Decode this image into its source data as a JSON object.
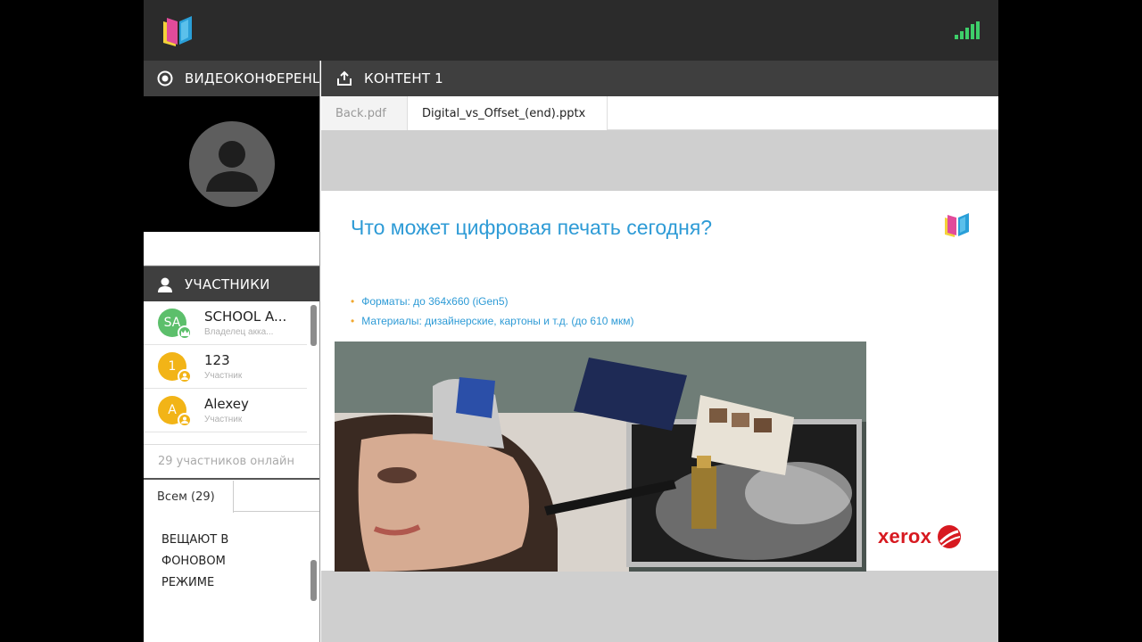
{
  "panels": {
    "video": {
      "title": "ВИДЕОКОНФЕРЕНЦИЯ"
    },
    "participants": {
      "title": "УЧАСТНИКИ"
    },
    "content": {
      "title": "КОНТЕНТ 1"
    }
  },
  "participants": [
    {
      "initials": "SA",
      "name": "SCHOOL A...",
      "role": "Владелец акка...",
      "color": "#5cbf6b",
      "badge_icon": "crown-icon"
    },
    {
      "initials": "1",
      "name": "123",
      "role": "Участник",
      "color": "#f2b417",
      "badge_icon": "user-icon"
    },
    {
      "initials": "A",
      "name": "Alexey",
      "role": "Участник",
      "color": "#f2b417",
      "badge_icon": "user-icon"
    }
  ],
  "online_count": "29 участников онлайн",
  "chat": {
    "tab_all": "Всем (29)",
    "message": "ВЕЩАЮТ В ФОНОВОМ РЕЖИМЕ"
  },
  "doc_tabs": [
    {
      "label": "Back.pdf",
      "active": false
    },
    {
      "label": "Digital_vs_Offset_(end).pptx",
      "active": true
    }
  ],
  "slide": {
    "title": "Что может цифровая печать сегодня?",
    "bullets": [
      "Форматы: до 364x660 (iGen5)",
      "Материалы: дизайнерские, картоны и т.д. (до 610 мкм)"
    ],
    "brand": "xerox"
  },
  "colors": {
    "topbar": "#2b2b2b",
    "panel_header": "#3f3f3f",
    "signal": "#3ecf6a",
    "slide_accent": "#2e9bd6",
    "xerox_red": "#d71920"
  }
}
